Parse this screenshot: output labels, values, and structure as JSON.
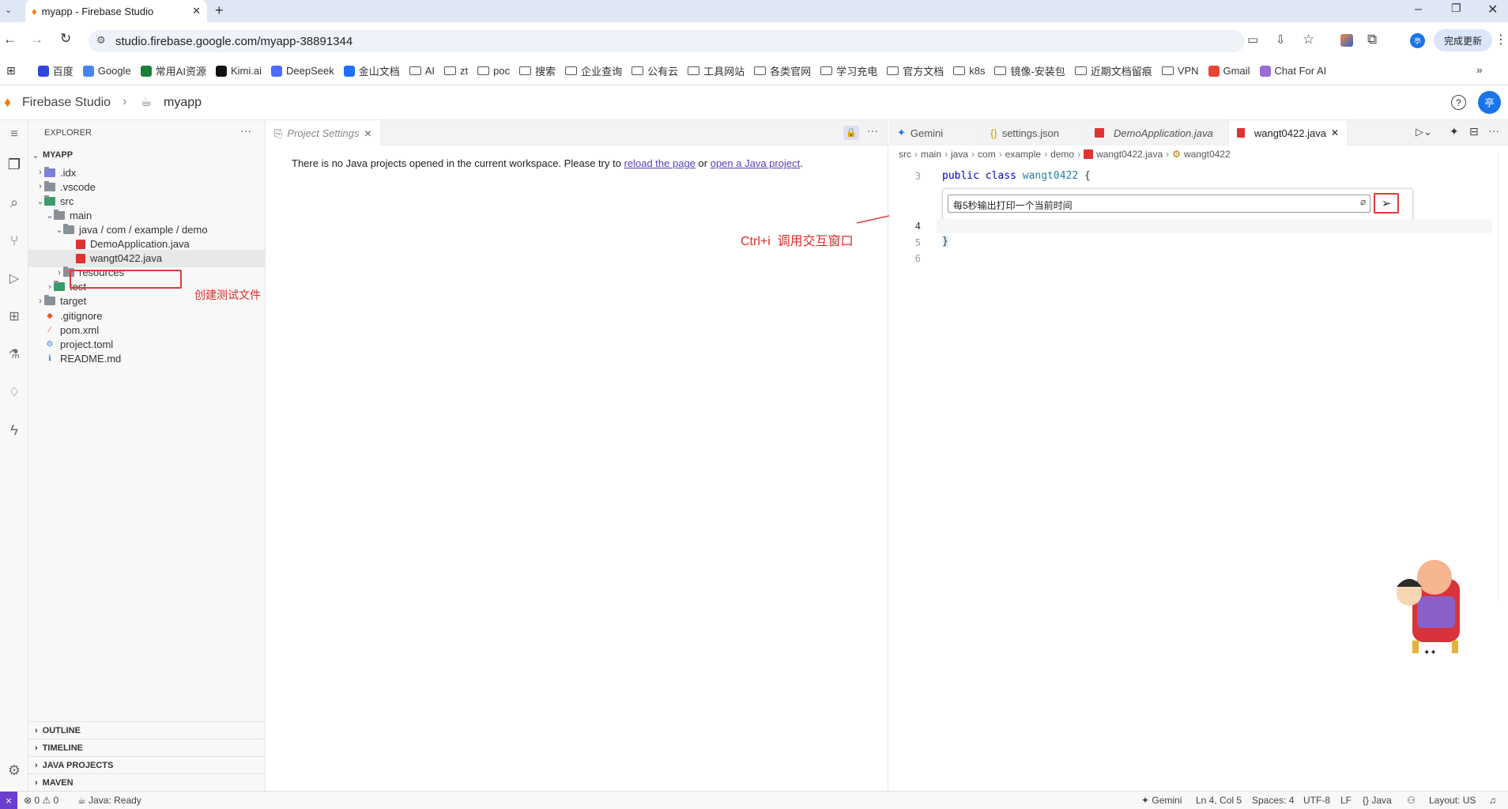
{
  "browser": {
    "tab_title": "myapp - Firebase Studio",
    "new_tab": "+",
    "url": "studio.firebase.google.com/myapp-38891344",
    "update_button": "完成更新",
    "profile_initial": "亭"
  },
  "bookmarks": [
    {
      "label": "百度",
      "icon": "baidu-icon"
    },
    {
      "label": "Google",
      "icon": "google-icon"
    },
    {
      "label": "常用AI资源",
      "icon": "bookmark-icon"
    },
    {
      "label": "Kimi.ai",
      "icon": "kimi-icon"
    },
    {
      "label": "DeepSeek",
      "icon": "deepseek-icon"
    },
    {
      "label": "金山文档",
      "icon": "kdocs-icon"
    },
    {
      "label": "AI",
      "icon": "folder-icon"
    },
    {
      "label": "zt",
      "icon": "folder-icon"
    },
    {
      "label": "poc",
      "icon": "folder-icon"
    },
    {
      "label": "搜索",
      "icon": "folder-icon"
    },
    {
      "label": "企业查询",
      "icon": "folder-icon"
    },
    {
      "label": "公有云",
      "icon": "folder-icon"
    },
    {
      "label": "工具网站",
      "icon": "folder-icon"
    },
    {
      "label": "各类官网",
      "icon": "folder-icon"
    },
    {
      "label": "学习充电",
      "icon": "folder-icon"
    },
    {
      "label": "官方文档",
      "icon": "folder-icon"
    },
    {
      "label": "k8s",
      "icon": "folder-icon"
    },
    {
      "label": "镜像-安装包",
      "icon": "folder-icon"
    },
    {
      "label": "近期文档留痕",
      "icon": "folder-icon"
    },
    {
      "label": "VPN",
      "icon": "folder-icon"
    },
    {
      "label": "Gmail",
      "icon": "gmail-icon"
    },
    {
      "label": "Chat For AI",
      "icon": "chat-icon"
    }
  ],
  "header": {
    "brand": "Firebase Studio",
    "project": "myapp",
    "user_initial": "亭"
  },
  "explorer": {
    "title": "EXPLORER",
    "root": "MYAPP",
    "items": [
      {
        "label": ".idx",
        "kind": "folder",
        "level": 1,
        "chev": "›"
      },
      {
        "label": ".vscode",
        "kind": "folder",
        "level": 1,
        "chev": "›"
      },
      {
        "label": "src",
        "kind": "folder",
        "level": 1,
        "chev": "⌄"
      },
      {
        "label": "main",
        "kind": "folder",
        "level": 2,
        "chev": "⌄"
      },
      {
        "label": "java / com / example / demo",
        "kind": "folder",
        "level": 3,
        "chev": "⌄"
      },
      {
        "label": "DemoApplication.java",
        "kind": "java",
        "level": 4,
        "chev": ""
      },
      {
        "label": "wangt0422.java",
        "kind": "java",
        "level": 4,
        "chev": ""
      },
      {
        "label": "resources",
        "kind": "folder",
        "level": 3,
        "chev": "›"
      },
      {
        "label": "test",
        "kind": "folder",
        "level": 2,
        "chev": "›"
      },
      {
        "label": "target",
        "kind": "folder",
        "level": 1,
        "chev": "›"
      },
      {
        "label": ".gitignore",
        "kind": "git",
        "level": 1,
        "chev": ""
      },
      {
        "label": "pom.xml",
        "kind": "xml",
        "level": 1,
        "chev": ""
      },
      {
        "label": "project.toml",
        "kind": "gear",
        "level": 1,
        "chev": ""
      },
      {
        "label": "README.md",
        "kind": "info",
        "level": 1,
        "chev": ""
      }
    ],
    "sections": [
      "OUTLINE",
      "TIMELINE",
      "JAVA PROJECTS",
      "MAVEN"
    ]
  },
  "annotations": {
    "create_file": "创建测试文件",
    "ctrl_i": "Ctrl+i  调用交互窗口"
  },
  "settings_editor": {
    "tab": "Project Settings",
    "message_before": "There is no Java projects opened in the current workspace. Please try to ",
    "link1": "reload the page",
    "message_mid": " or ",
    "link2": "open a Java project",
    "message_after": "."
  },
  "code_editor": {
    "tabs": [
      "Gemini",
      "settings.json",
      "DemoApplication.java",
      "wangt0422.java"
    ],
    "breadcrumb": [
      "src",
      "main",
      "java",
      "com",
      "example",
      "demo",
      "wangt0422.java",
      "wangt0422"
    ],
    "lines": [
      {
        "n": "3",
        "text_kw": "public class",
        "text_name": "wangt0422",
        "text_rest": " {"
      },
      {
        "n": "4",
        "text": ""
      },
      {
        "n": "5",
        "text": "}"
      },
      {
        "n": "6",
        "text": ""
      }
    ],
    "inline_prompt": "每5秒输出打印一个当前时间"
  },
  "status": {
    "problems": "0",
    "warnings": "0",
    "java": "Java: Ready",
    "gemini": "Gemini",
    "position": "Ln 4, Col 5",
    "spaces": "Spaces: 4",
    "encoding": "UTF-8",
    "eol": "LF",
    "language": "Java",
    "layout": "Layout: US"
  },
  "colors": {
    "accent": "#1a73e8",
    "annotation": "#e02b2b",
    "java_icon": "#d33333",
    "firebase": "#f57c00"
  }
}
